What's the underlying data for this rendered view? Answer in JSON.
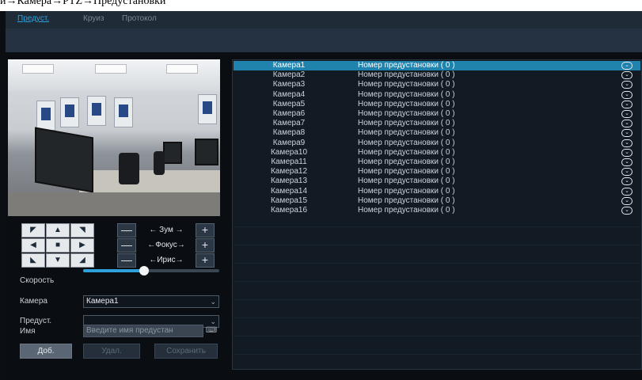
{
  "breadcrumb": "и→Камера→PTZ→Предустановки",
  "tabs": [
    {
      "label": "Предуст.",
      "active": true
    },
    {
      "label": "Круиз",
      "active": false
    },
    {
      "label": "Протокол",
      "active": false
    }
  ],
  "ptz": {
    "zoom_label": "←   Зум   →",
    "focus_label": "←Фокус→",
    "iris_label": "←Ирис→",
    "minus": "—",
    "plus": "+"
  },
  "form": {
    "speed_label": "Скорость",
    "speed_value": 0.45,
    "camera_label": "Камера",
    "camera_value": "Камера1",
    "preset_label": "Предуст.",
    "preset_value": "",
    "name_label": "Имя",
    "name_placeholder": "Введите имя предустан",
    "add_button": "Доб.",
    "delete_button": "Удал.",
    "save_button": "Сохранить"
  },
  "presets": [
    {
      "camera": "Камера1",
      "preset": "Номер предустановки ( 0 )",
      "selected": true
    },
    {
      "camera": "Камера2",
      "preset": "Номер предустановки ( 0 )"
    },
    {
      "camera": "Камера3",
      "preset": "Номер предустановки ( 0 )"
    },
    {
      "camera": "Камера4",
      "preset": "Номер предустановки ( 0 )"
    },
    {
      "camera": "Камера5",
      "preset": "Номер предустановки ( 0 )"
    },
    {
      "camera": "Камера6",
      "preset": "Номер предустановки ( 0 )"
    },
    {
      "camera": "Камера7",
      "preset": "Номер предустановки ( 0 )"
    },
    {
      "camera": "Камера8",
      "preset": "Номер предустановки ( 0 )"
    },
    {
      "camera": "Камера9",
      "preset": "Номер предустановки ( 0 )"
    },
    {
      "camera": "Камера10",
      "preset": "Номер предустановки ( 0 )"
    },
    {
      "camera": "Камера11",
      "preset": "Номер предустановки ( 0 )"
    },
    {
      "camera": "Камера12",
      "preset": "Номер предустановки ( 0 )"
    },
    {
      "camera": "Камера13",
      "preset": "Номер предустановки ( 0 )"
    },
    {
      "camera": "Камера14",
      "preset": "Номер предустановки ( 0 )"
    },
    {
      "camera": "Камера15",
      "preset": "Номер предустановки ( 0 )"
    },
    {
      "camera": "Камера16",
      "preset": "Номер предустановки ( 0 )"
    }
  ],
  "colors": {
    "accent": "#2ea1dc",
    "selected_row": "#1f83ad"
  }
}
